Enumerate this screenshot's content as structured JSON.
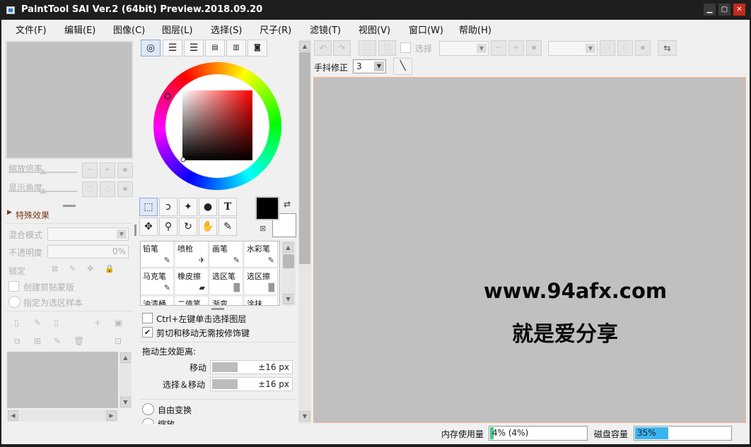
{
  "window": {
    "title": "PaintTool SAI Ver.2 (64bit) Preview.2018.09.20"
  },
  "menu": {
    "items": [
      "文件(F)",
      "编辑(E)",
      "图像(C)",
      "图层(L)",
      "选择(S)",
      "尺子(R)",
      "滤镜(T)",
      "视图(V)",
      "窗口(W)",
      "帮助(H)"
    ]
  },
  "navigator": {
    "zoom_label": "缩放倍率",
    "rotate_label": "显示角度"
  },
  "layer_props": {
    "effects_label": "特殊效果",
    "blend_label": "混合模式",
    "opacity_label": "不透明度",
    "opacity_value": "0%",
    "lock_label": "锁定",
    "clip_label": "创建剪贴蒙版",
    "selection_source_label": "指定为选区样本"
  },
  "colors": {
    "primary": "#000000",
    "secondary": "#ffffff",
    "hue_marker": "#c000c0"
  },
  "brushes": [
    [
      "铅笔",
      "喷枪",
      "画笔",
      "水彩笔"
    ],
    [
      "马克笔",
      "橡皮擦",
      "选区笔",
      "选区擦"
    ],
    [
      "油漆桶",
      "二值笔",
      "渐变",
      "涂抹"
    ]
  ],
  "options": {
    "ctrl_select_label": "Ctrl+左键单击选择图层",
    "cut_move_label": "剪切和移动无需按修饰键",
    "drag_distance_label": "拖动生效距离:",
    "move_label": "移动",
    "move_value": "±16 px",
    "select_move_label": "选择＆移动",
    "select_move_value": "±16 px",
    "free_transform_label": "自由变换",
    "zoom_label": "缩放"
  },
  "toolbar": {
    "select_label": "选择",
    "stabilizer_label": "手抖修正",
    "stabilizer_value": "3"
  },
  "canvas": {
    "watermark_url": "www.94afx.com",
    "watermark_text": "就是爱分享"
  },
  "status": {
    "memory_label": "内存使用量",
    "memory_value": "4% (4%)",
    "memory_pct": 4,
    "disk_label": "磁盘容量",
    "disk_value": "35%",
    "disk_pct": 35,
    "memory_color": "#3cc88c",
    "disk_color": "#3ab4f0"
  }
}
